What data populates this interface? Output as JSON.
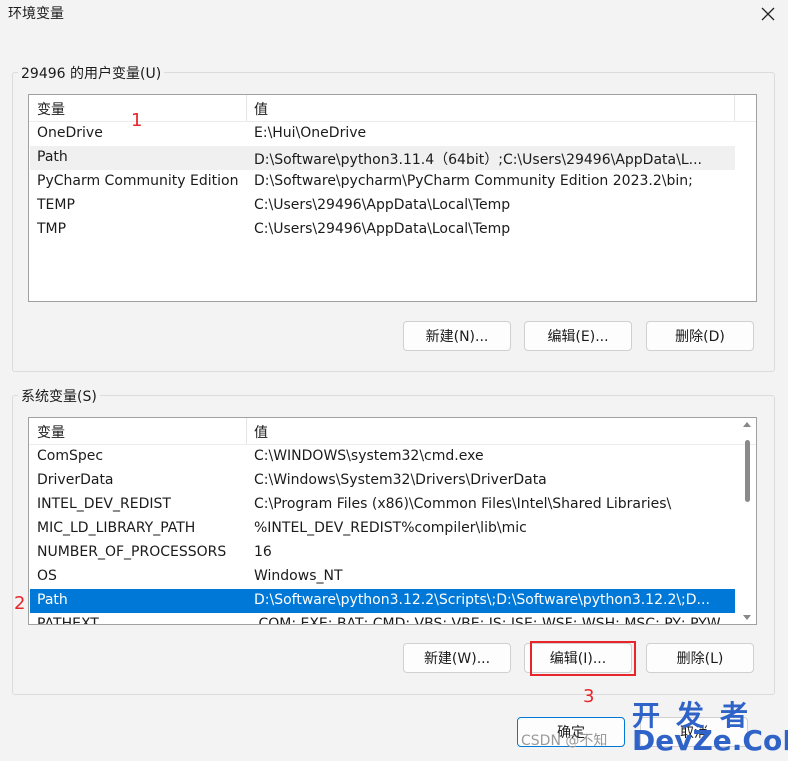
{
  "window": {
    "title": "环境变量"
  },
  "user_group": {
    "label": "29496 的用户变量(U)",
    "columns": [
      "变量",
      "值"
    ],
    "rows": [
      {
        "name": "OneDrive",
        "value": "E:\\Hui\\OneDrive"
      },
      {
        "name": "Path",
        "value": "D:\\Software\\python3.11.4（64bit）;C:\\Users\\29496\\AppData\\L..."
      },
      {
        "name": "PyCharm Community Edition",
        "value": "D:\\Software\\pycharm\\PyCharm Community Edition 2023.2\\bin;"
      },
      {
        "name": "TEMP",
        "value": "C:\\Users\\29496\\AppData\\Local\\Temp"
      },
      {
        "name": "TMP",
        "value": "C:\\Users\\29496\\AppData\\Local\\Temp"
      }
    ],
    "buttons": {
      "new": "新建(N)...",
      "edit": "编辑(E)...",
      "delete": "删除(D)"
    }
  },
  "system_group": {
    "label": "系统变量(S)",
    "columns": [
      "变量",
      "值"
    ],
    "rows": [
      {
        "name": "ComSpec",
        "value": "C:\\WINDOWS\\system32\\cmd.exe"
      },
      {
        "name": "DriverData",
        "value": "C:\\Windows\\System32\\Drivers\\DriverData"
      },
      {
        "name": "INTEL_DEV_REDIST",
        "value": "C:\\Program Files (x86)\\Common Files\\Intel\\Shared Libraries\\"
      },
      {
        "name": "MIC_LD_LIBRARY_PATH",
        "value": "%INTEL_DEV_REDIST%compiler\\lib\\mic"
      },
      {
        "name": "NUMBER_OF_PROCESSORS",
        "value": "16"
      },
      {
        "name": "OS",
        "value": "Windows_NT"
      },
      {
        "name": "Path",
        "value": "D:\\Software\\python3.12.2\\Scripts\\;D:\\Software\\python3.12.2\\;D..."
      },
      {
        "name": "PATHEXT",
        "value": ".COM;.EXE;.BAT;.CMD;.VBS;.VBE;.JS;.JSE;.WSF;.WSH;.MSC;.PY;.PYW"
      }
    ],
    "buttons": {
      "new": "新建(W)...",
      "edit": "编辑(I)...",
      "delete": "删除(L)"
    }
  },
  "footer": {
    "ok": "确定",
    "cancel": "取消"
  },
  "annotations": {
    "a1": "1",
    "a2": "2",
    "a3": "3"
  },
  "watermarks": {
    "csdn": "CSDN @不知",
    "cn": "开发者",
    "en": "DevZe.CoM"
  },
  "colors": {
    "selection": "#0078d7",
    "annotation": "#e8262a",
    "watermark": "#2f63c7"
  }
}
